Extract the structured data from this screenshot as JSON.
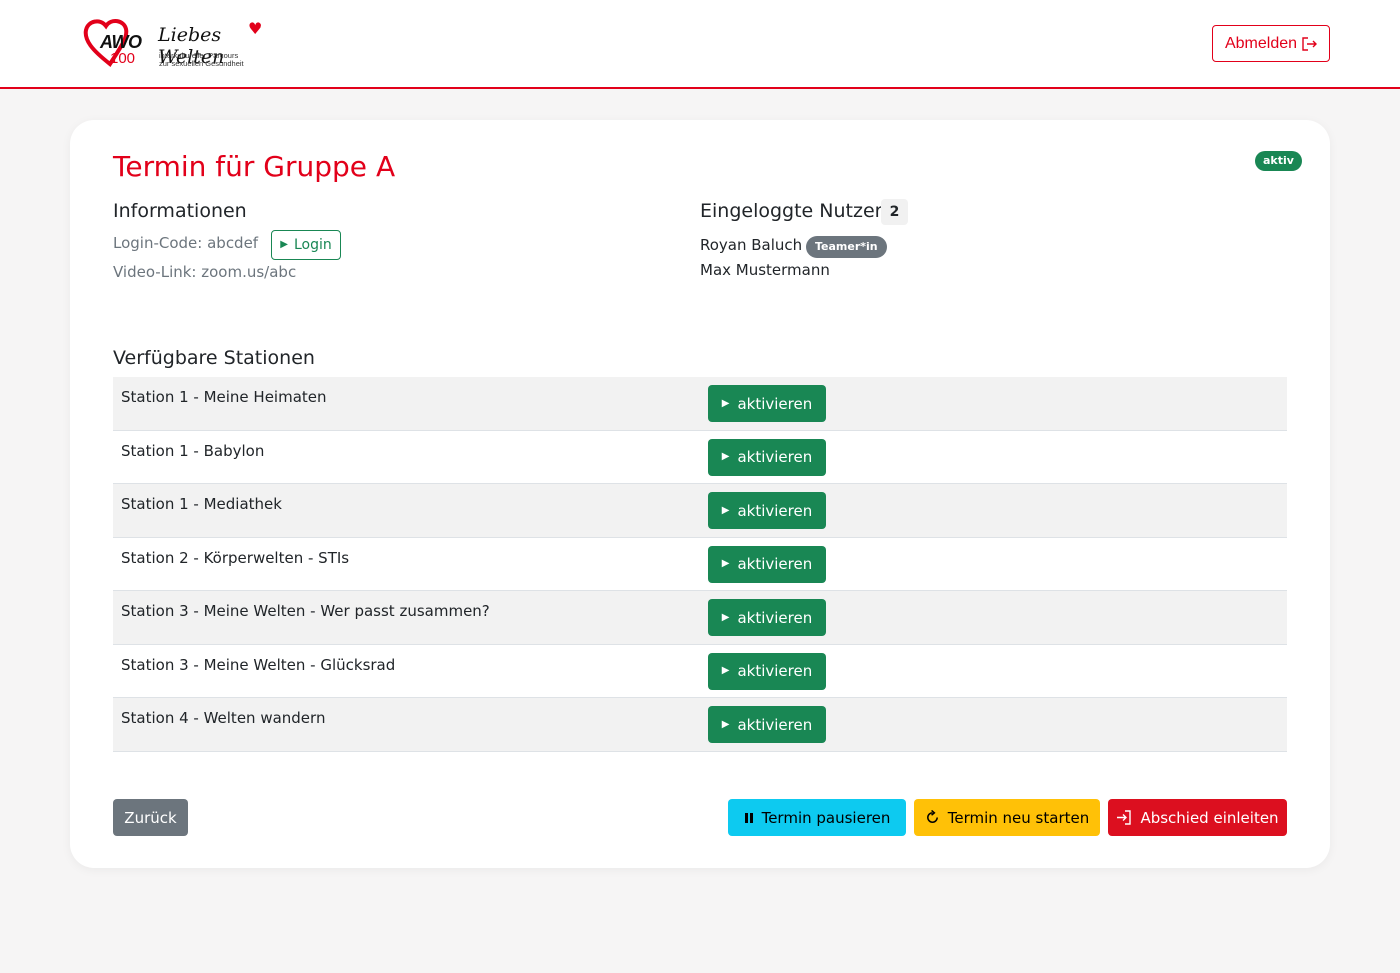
{
  "header": {
    "logo": {
      "awo_text": "AWO",
      "awo_100": "100",
      "liebes_welten": "Liebes Welten",
      "sub_line1": "interkultureller Parcours",
      "sub_line2": "zur sexuellen Gesundheit"
    },
    "logout_label": "Abmelden",
    "logout_icon": "logout-icon"
  },
  "page": {
    "title": "Termin für Gruppe A",
    "status_badge": "aktiv"
  },
  "info": {
    "heading": "Informationen",
    "login_code": "Login-Code: abcdef",
    "video_link": "Video-Link: zoom.us/abc",
    "login_button": "Login"
  },
  "users": {
    "heading": "Eingeloggte Nutzer",
    "count": "2",
    "list": [
      {
        "name": "Royan Baluch",
        "role": "Teamer*in"
      },
      {
        "name": "Max Mustermann"
      }
    ]
  },
  "stations": {
    "heading": "Verfügbare Stationen",
    "activate_label": "aktivieren",
    "items": [
      "Station 1 - Meine Heimaten",
      "Station 1 - Babylon",
      "Station 1 - Mediathek",
      "Station 2 - Körperwelten - STIs",
      "Station 3 - Meine Welten - Wer passt zusammen?",
      "Station 3 - Meine Welten - Glücksrad",
      "Station 4 - Welten wandern"
    ]
  },
  "footer": {
    "back": "Zurück",
    "pause": "Termin pausieren",
    "restart": "Termin neu starten",
    "farewell": "Abschied einleiten"
  },
  "colors": {
    "brand_red": "#e2001a",
    "success": "#198754",
    "info": "#0dcaf0",
    "warning": "#ffc107",
    "secondary": "#6c757d"
  }
}
